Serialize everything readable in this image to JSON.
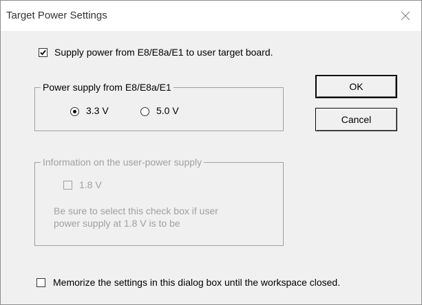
{
  "window": {
    "title": "Target Power Settings"
  },
  "supply_power": {
    "label": "Supply power from E8/E8a/E1 to user target board.",
    "checked": true
  },
  "power_group": {
    "legend": "Power supply from E8/E8a/E1",
    "options": [
      {
        "label": "3.3 V",
        "selected": true
      },
      {
        "label": "5.0 V",
        "selected": false
      }
    ]
  },
  "buttons": {
    "ok": "OK",
    "cancel": "Cancel"
  },
  "info_group": {
    "legend": "Information on the user-power supply",
    "checkbox_label": "1.8 V",
    "checked": false,
    "enabled": false,
    "help_text": "Be sure to select this check box if user power supply at 1.8 V is to be"
  },
  "memorize": {
    "label": "Memorize the settings in this dialog box until the workspace closed.",
    "checked": false
  },
  "icons": {
    "close": "close-icon",
    "check": "checkmark-icon"
  }
}
